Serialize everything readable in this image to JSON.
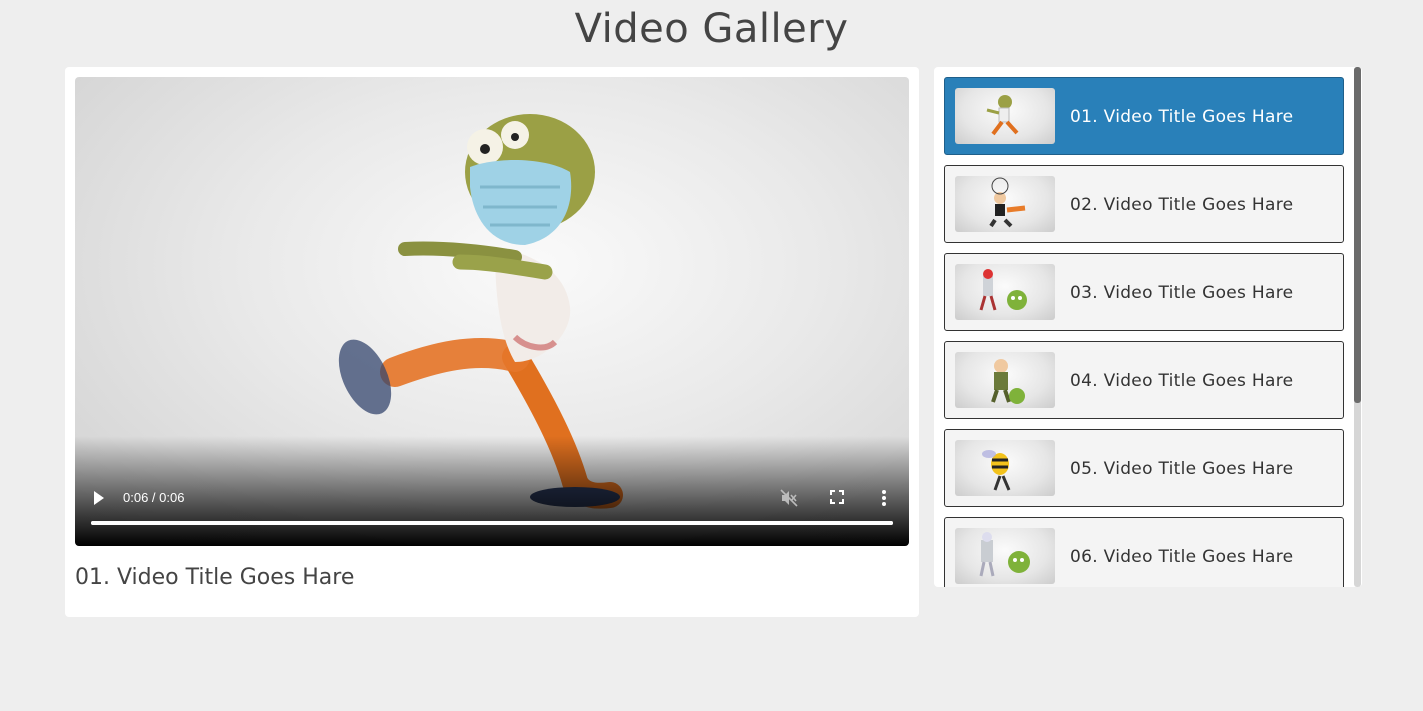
{
  "page": {
    "title": "Video Gallery"
  },
  "player": {
    "time_display": "0:06 / 0:06",
    "progress": 1.0,
    "muted": true,
    "now_playing_title": "01. Video Title Goes Hare",
    "controls": {
      "play_icon": "play-icon",
      "mute_icon": "volume-muted-icon",
      "fullscreen_icon": "fullscreen-icon",
      "more_icon": "more-vertical-icon"
    }
  },
  "playlist": {
    "active_index": 0,
    "accent_color": "#2980b9",
    "items": [
      {
        "label": "01. Video Title Goes Hare",
        "thumbnail": "zombie-character-thumbnail"
      },
      {
        "label": "02. Video Title Goes Hare",
        "thumbnail": "jump-rope-character-thumbnail"
      },
      {
        "label": "03. Video Title Goes Hare",
        "thumbnail": "knight-and-virus-thumbnail"
      },
      {
        "label": "04. Video Title Goes Hare",
        "thumbnail": "soldier-and-virus-thumbnail"
      },
      {
        "label": "05. Video Title Goes Hare",
        "thumbnail": "bee-character-thumbnail"
      },
      {
        "label": "06. Video Title Goes Hare",
        "thumbnail": "robot-and-virus-thumbnail"
      }
    ]
  }
}
